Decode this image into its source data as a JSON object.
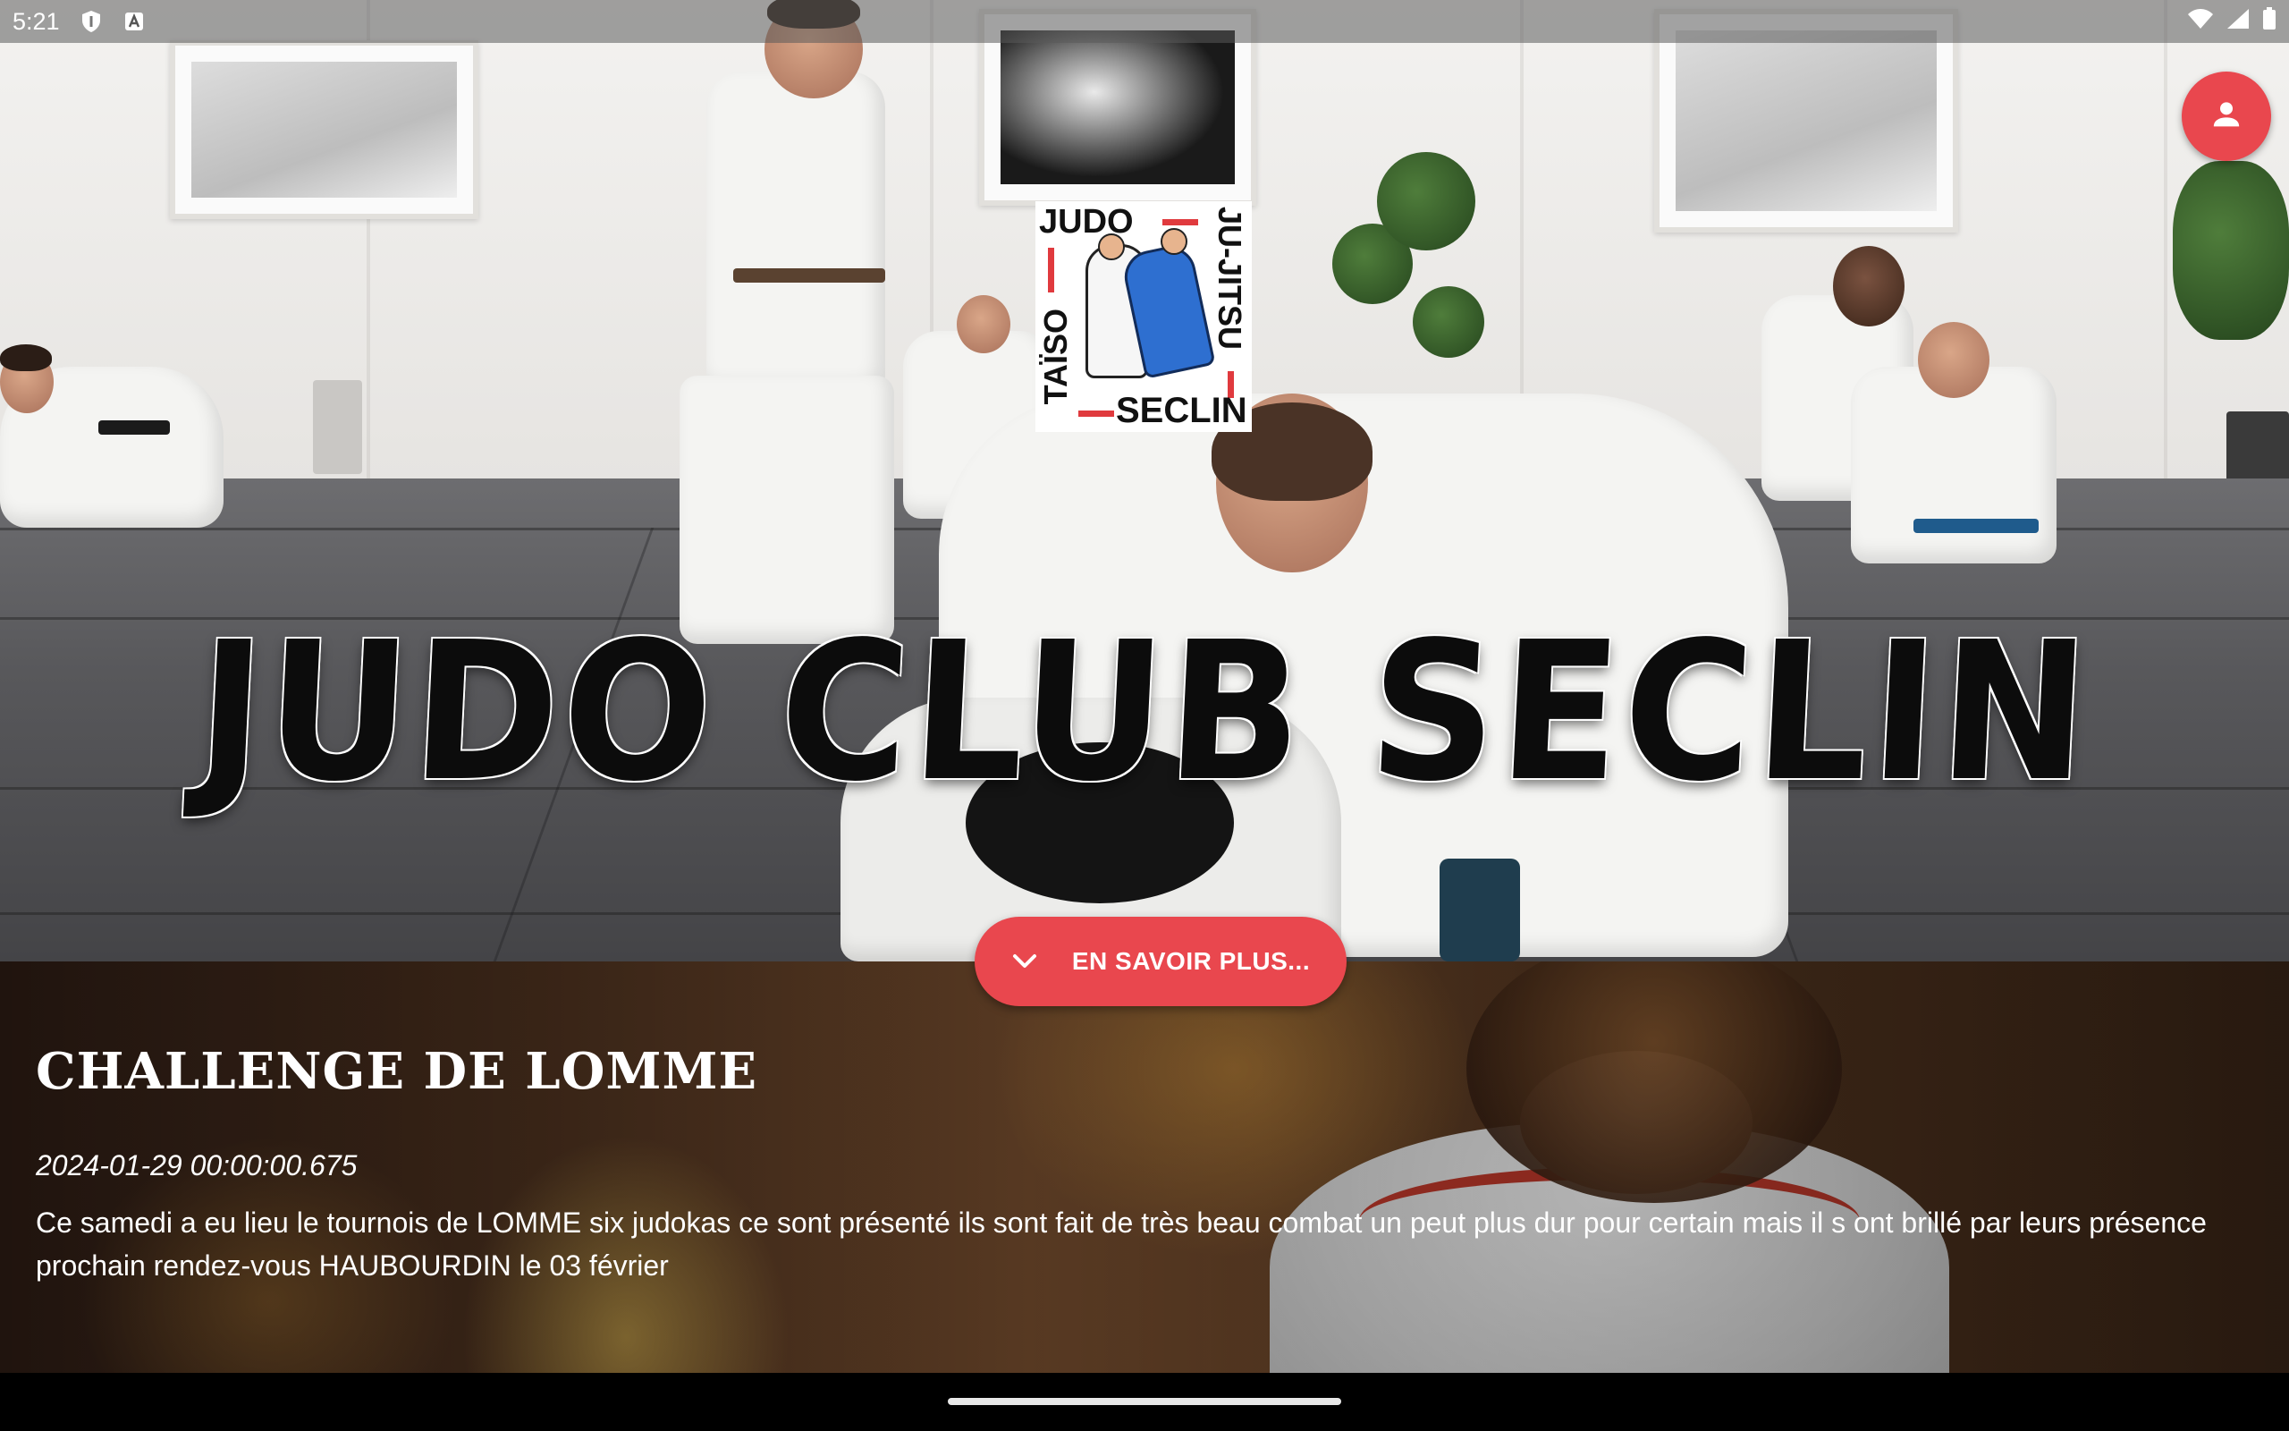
{
  "status_bar": {
    "time": "5:21",
    "left_icons": [
      "shield-icon",
      "font-icon"
    ],
    "right_icons": [
      "wifi-icon",
      "signal-icon",
      "battery-icon"
    ]
  },
  "hero": {
    "title": "JUDO CLUB SECLIN",
    "logo": {
      "top": "JUDO",
      "right": "JU-JITSU",
      "left": "TAÏSO",
      "bottom": "SECLIN"
    }
  },
  "account_button": {
    "icon": "person-icon"
  },
  "more_button": {
    "label": "EN SAVOIR PLUS...",
    "icon": "chevron-down-icon"
  },
  "news": {
    "title": "CHALLENGE DE LOMME",
    "date": "2024-01-29 00:00:00.675",
    "body": "Ce samedi a eu lieu le tournois de LOMME six judokas ce sont présenté ils sont fait de très beau combat un peut plus dur pour certain mais il s ont brillé par leurs présence prochain rendez-vous HAUBOURDIN le 03 février"
  },
  "colors": {
    "accent": "#e9474e",
    "logo_red": "#e03a3e",
    "logo_blue": "#2e6fd0"
  }
}
